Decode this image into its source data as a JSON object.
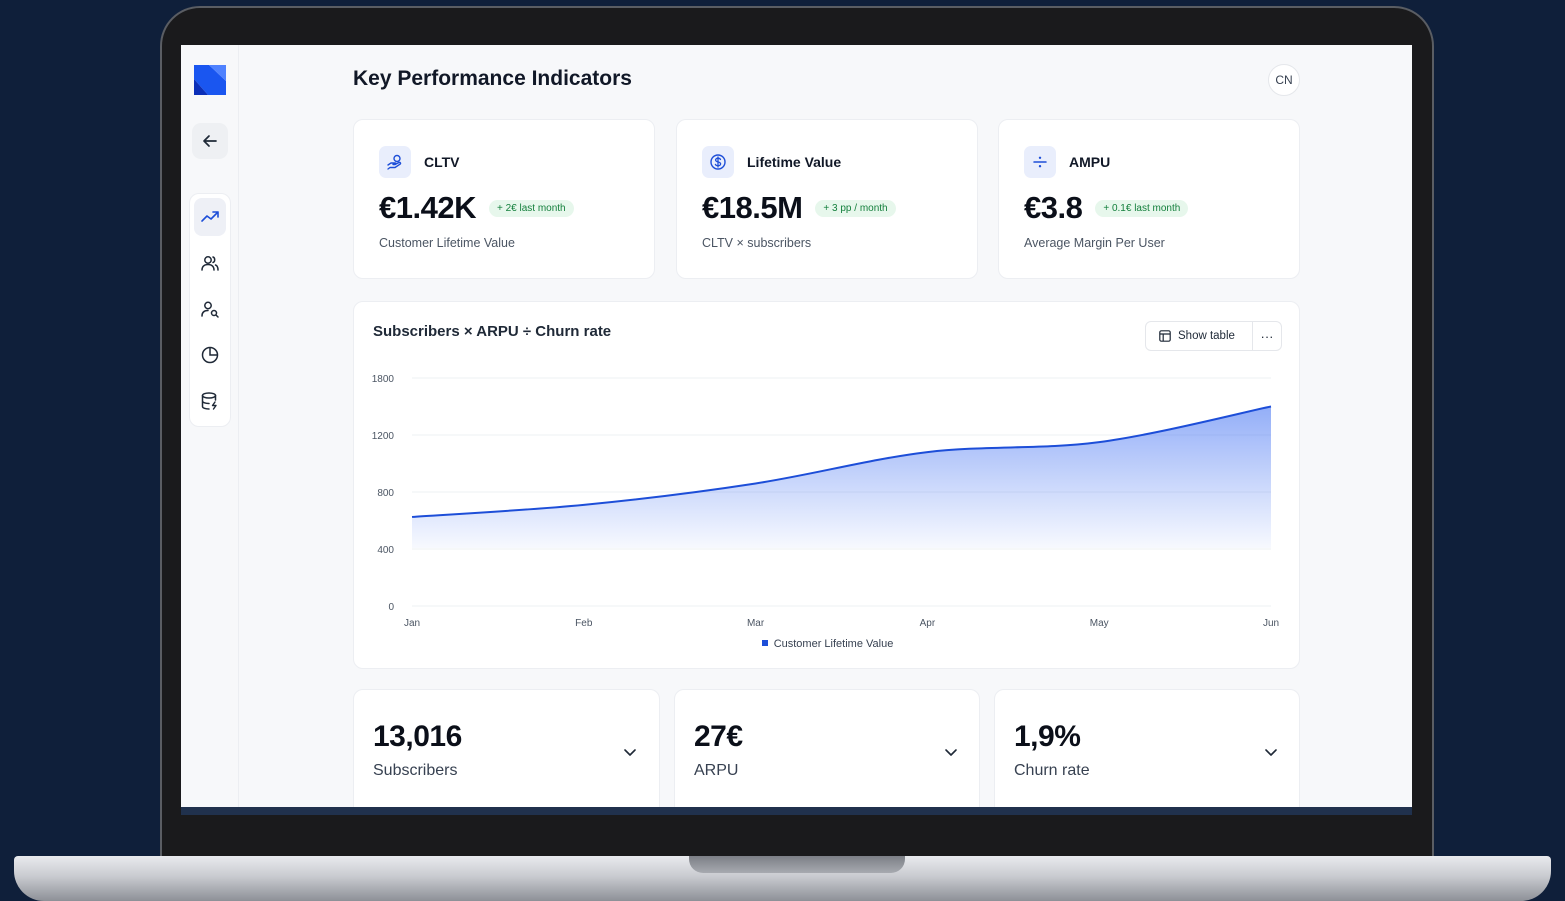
{
  "header": {
    "title": "Key Performance Indicators",
    "avatar": "CN"
  },
  "sidebar": {
    "items": [
      {
        "name": "trend-icon",
        "active": true
      },
      {
        "name": "users-icon",
        "active": false
      },
      {
        "name": "user-search-icon",
        "active": false
      },
      {
        "name": "pie-chart-icon",
        "active": false
      },
      {
        "name": "database-icon",
        "active": false
      }
    ]
  },
  "kpis": [
    {
      "icon": "hand-coins-icon",
      "label": "CLTV",
      "value": "€1.42K",
      "badge": "+ 2€ last month",
      "desc": "Customer Lifetime Value"
    },
    {
      "icon": "dollar-circle-icon",
      "label": "Lifetime Value",
      "value": "€18.5M",
      "badge": "+ 3 pp / month",
      "desc": "CLTV × subscribers"
    },
    {
      "icon": "divide-icon",
      "label": "AMPU",
      "value": "€3.8",
      "badge": "+ 0.1€ last month",
      "desc": "Average Margin Per User"
    }
  ],
  "chart": {
    "show_table": "Show table",
    "more": "···"
  },
  "chart_data": {
    "type": "area",
    "title": "Subscribers × ARPU ÷ Churn rate",
    "x": [
      "Jan",
      "Feb",
      "Mar",
      "Apr",
      "May",
      "Jun"
    ],
    "series": [
      {
        "name": "Customer Lifetime Value",
        "values": [
          625,
          710,
          860,
          1080,
          1150,
          1500
        ]
      }
    ],
    "yticks": [
      0,
      400,
      800,
      1200,
      1800
    ],
    "ylim": [
      0,
      1800
    ],
    "grid": true,
    "legend": "bottom",
    "color": "#1d4ed8"
  },
  "metrics": [
    {
      "value": "13,016",
      "label": "Subscribers"
    },
    {
      "value": "27€",
      "label": "ARPU"
    },
    {
      "value": "1,9%",
      "label": "Churn rate"
    }
  ]
}
